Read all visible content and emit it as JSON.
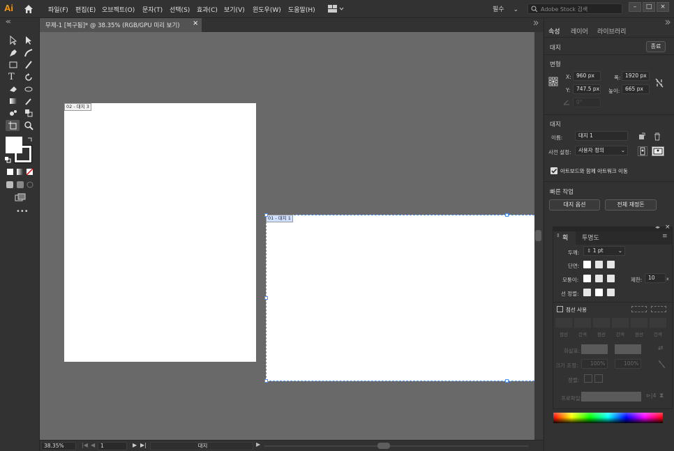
{
  "app": {
    "logo": "Ai"
  },
  "menu": [
    "파일(F)",
    "편집(E)",
    "오브젝트(O)",
    "문자(T)",
    "선택(S)",
    "효과(C)",
    "보기(V)",
    "윈도우(W)",
    "도움말(H)"
  ],
  "workspace": {
    "label": "필수",
    "chevron": "⌄"
  },
  "stock_search": {
    "placeholder": "Adobe Stock 검색"
  },
  "window_controls": {
    "minimize": "–",
    "maximize": "□",
    "close": "×"
  },
  "document_tab": {
    "title": "무제-1 [복구됨]* @ 38.35% (RGB/GPU 미리 보기)",
    "close": "×"
  },
  "artboards": [
    {
      "label": "02 - 대지 3"
    },
    {
      "label": "01 - 대지 1"
    }
  ],
  "statusbar": {
    "zoom": "38.35%",
    "artboard_number": "1",
    "tool_label": "대지"
  },
  "panel_tabs": [
    "속성",
    "레이어",
    "라이브러리"
  ],
  "properties": {
    "section": "대지",
    "exit_button": "종료",
    "transform": {
      "title": "변형",
      "x_label": "X:",
      "x_value": "960 px",
      "y_label": "Y:",
      "y_value": "747.5 px",
      "w_label": "폭:",
      "w_value": "1920 px",
      "h_label": "높이:",
      "h_value": "665 px",
      "angle_value": "0°"
    },
    "artboard": {
      "title": "대지",
      "name_label": "이름:",
      "name_value": "대지 1",
      "preset_label": "사전 설정:",
      "preset_value": "사용자 정의",
      "move_with_artwork": "아트보드와 함께 아트워크 이동",
      "move_with_artwork_checked": true
    },
    "quick_actions": {
      "title": "빠른 작업",
      "artboard_options": "대지 옵션",
      "rearrange_all": "전체 재정돈"
    }
  },
  "stroke_panel": {
    "tabs": [
      "획",
      "투명도"
    ],
    "weight_label": "두께:",
    "weight_value": "1 pt",
    "cap_label": "단면:",
    "corner_label": "모퉁이:",
    "limit_label": "제한:",
    "limit_value": "10",
    "limit_unit": "x",
    "align_label": "선 정렬:",
    "dashed_label": "점선 사용",
    "dash_headers": [
      "점선",
      "간격",
      "점선",
      "간격",
      "점선",
      "간격"
    ],
    "arrowheads_label": "화살표:",
    "scale_label": "크기 조정:",
    "scale_value_1": "100%",
    "scale_value_2": "100%",
    "align_arrow_label": "정렬:",
    "profile_label": "프로파일:"
  }
}
